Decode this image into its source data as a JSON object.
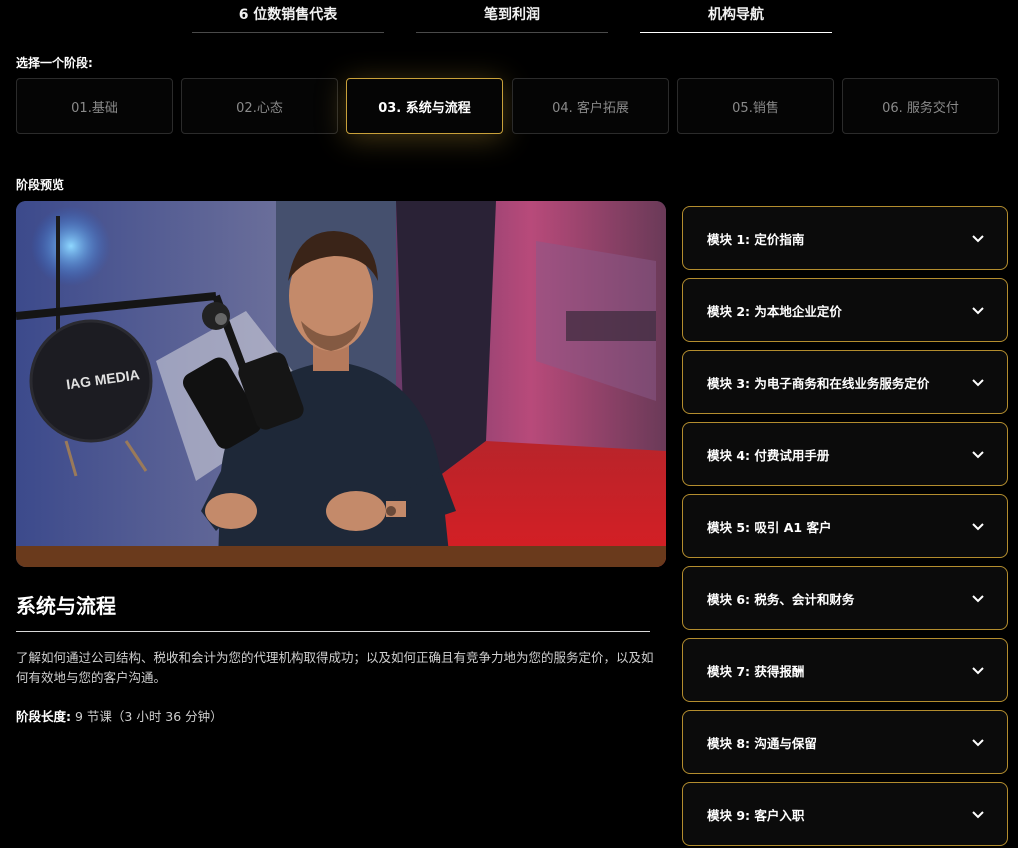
{
  "tabs": [
    {
      "label": "6 位数销售代表"
    },
    {
      "label": "笔到利润"
    },
    {
      "label": "机构导航"
    }
  ],
  "stage_select_label": "选择一个阶段:",
  "stages": [
    {
      "label": "01.基础"
    },
    {
      "label": "02.心态"
    },
    {
      "label": "03. 系统与流程"
    },
    {
      "label": "04. 客户拓展"
    },
    {
      "label": "05.销售"
    },
    {
      "label": "06. 服务交付"
    }
  ],
  "active_stage_index": 2,
  "preview_label": "阶段预览",
  "preview_logo_text": "IAG MEDIA",
  "stage_title": "系统与流程",
  "stage_description": "了解如何通过公司结构、税收和会计为您的代理机构取得成功；以及如何正确且有竞争力地为您的服务定价，以及如何有效地与您的客户沟通。",
  "stage_length_label": "阶段长度:",
  "stage_length_value": " 9 节课（3 小时 36 分钟）",
  "modules": [
    {
      "label": "模块 1:  定价指南"
    },
    {
      "label": "模块 2:  为本地企业定价"
    },
    {
      "label": "模块 3:  为电子商务和在线业务服务定价"
    },
    {
      "label": "模块 4:  付费试用手册"
    },
    {
      "label": "模块 5:  吸引 A1 客户"
    },
    {
      "label": "模块 6:  税务、会计和财务"
    },
    {
      "label": "模块 7:  获得报酬"
    },
    {
      "label": "模块 8:  沟通与保留"
    },
    {
      "label": "模块 9:  客户入职"
    }
  ],
  "colors": {
    "accent_gold": "#c9a13a",
    "module_border": "#b38d2e",
    "background": "#000000"
  },
  "icons": {
    "module_toggle": "chevron-down-icon"
  }
}
